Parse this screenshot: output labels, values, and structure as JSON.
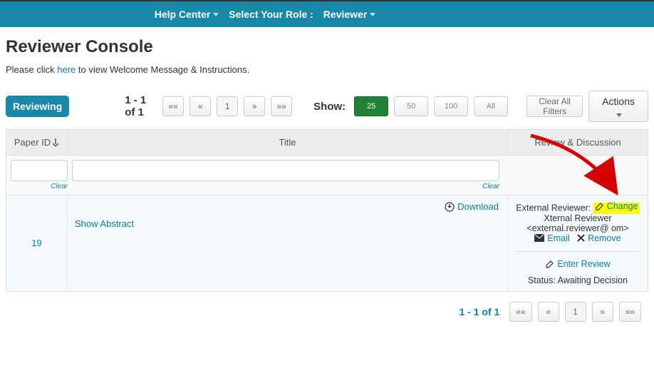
{
  "topbar": {
    "help": "Help Center",
    "select_role": "Select Your Role :",
    "reviewer": "Reviewer"
  },
  "page": {
    "title": "Reviewer Console",
    "instr_prefix": "Please click ",
    "instr_link": "here",
    "instr_suffix": " to view Welcome Message & Instructions."
  },
  "toolbar": {
    "reviewing": "Reviewing",
    "pager_text": "1 - 1 of 1",
    "pager": {
      "first": "««",
      "prev": "«",
      "page": "1",
      "next": "»",
      "last": "»»"
    },
    "show_label": "Show:",
    "show": {
      "opt25": "25",
      "opt50": "50",
      "opt100": "100",
      "optAll": "All"
    },
    "clear_filters": "Clear All Filters",
    "actions": "Actions"
  },
  "grid": {
    "head": {
      "paper_id": "Paper ID",
      "title": "Title",
      "rd": "Review & Discussion"
    },
    "filter": {
      "clear": "Clear"
    },
    "row": {
      "id": "19",
      "title": "",
      "download": "Download",
      "show_abstract": "Show Abstract",
      "rd": {
        "ext_label": "External Reviewer:",
        "change": "Change",
        "name": "Xternal Reviewer",
        "email_addr": "<external.reviewer@           om>",
        "email": "Email",
        "remove": "Remove",
        "enter_review": "Enter Review",
        "status": "Status: Awaiting Decision"
      }
    }
  },
  "footer": {
    "pager_text": "1 - 1 of 1"
  }
}
